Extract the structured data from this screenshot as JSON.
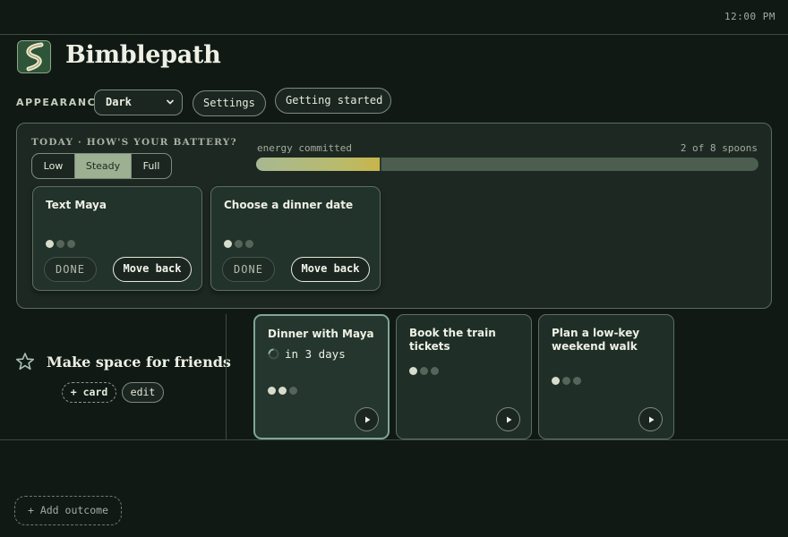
{
  "status_bar": {
    "time": "12:00 PM"
  },
  "header": {
    "app_title": "Bimblepath",
    "logo_icon": "winding-path-logo"
  },
  "appearance": {
    "label": "APPEARANCE",
    "theme_value": "Dark",
    "settings_label": "Settings",
    "getting_started_label": "Getting started"
  },
  "today": {
    "label": "TODAY · HOW'S YOUR BATTERY?",
    "battery_options": [
      "Low",
      "Steady",
      "Full"
    ],
    "battery_selected": "Steady",
    "energy_label": "energy committed",
    "energy_count": "2 of 8 spoons",
    "energy_committed": 2,
    "energy_total": 8,
    "cards": [
      {
        "title": "Text Maya",
        "spoons": 1,
        "done_label": "DONE",
        "move_back_label": "Move back"
      },
      {
        "title": "Choose a dinner date",
        "spoons": 1,
        "done_label": "DONE",
        "move_back_label": "Move back"
      }
    ]
  },
  "outcome": {
    "title": "Make space for friends",
    "add_card_label": "+ card",
    "edit_label": "edit",
    "steps": [
      {
        "title": "Dinner with Maya",
        "due": "in 3 days",
        "spoons": 2,
        "active": true
      },
      {
        "title": "Book the train tickets",
        "spoons": 1,
        "active": false
      },
      {
        "title": "Plan a low-key weekend walk",
        "spoons": 1,
        "active": false
      }
    ]
  },
  "add_outcome_label": "+ Add outcome",
  "colors": {
    "background": "#111915",
    "panel": "#1c2821",
    "accent_sage": "#9cb092",
    "energy_gold": "#c9b44a"
  }
}
